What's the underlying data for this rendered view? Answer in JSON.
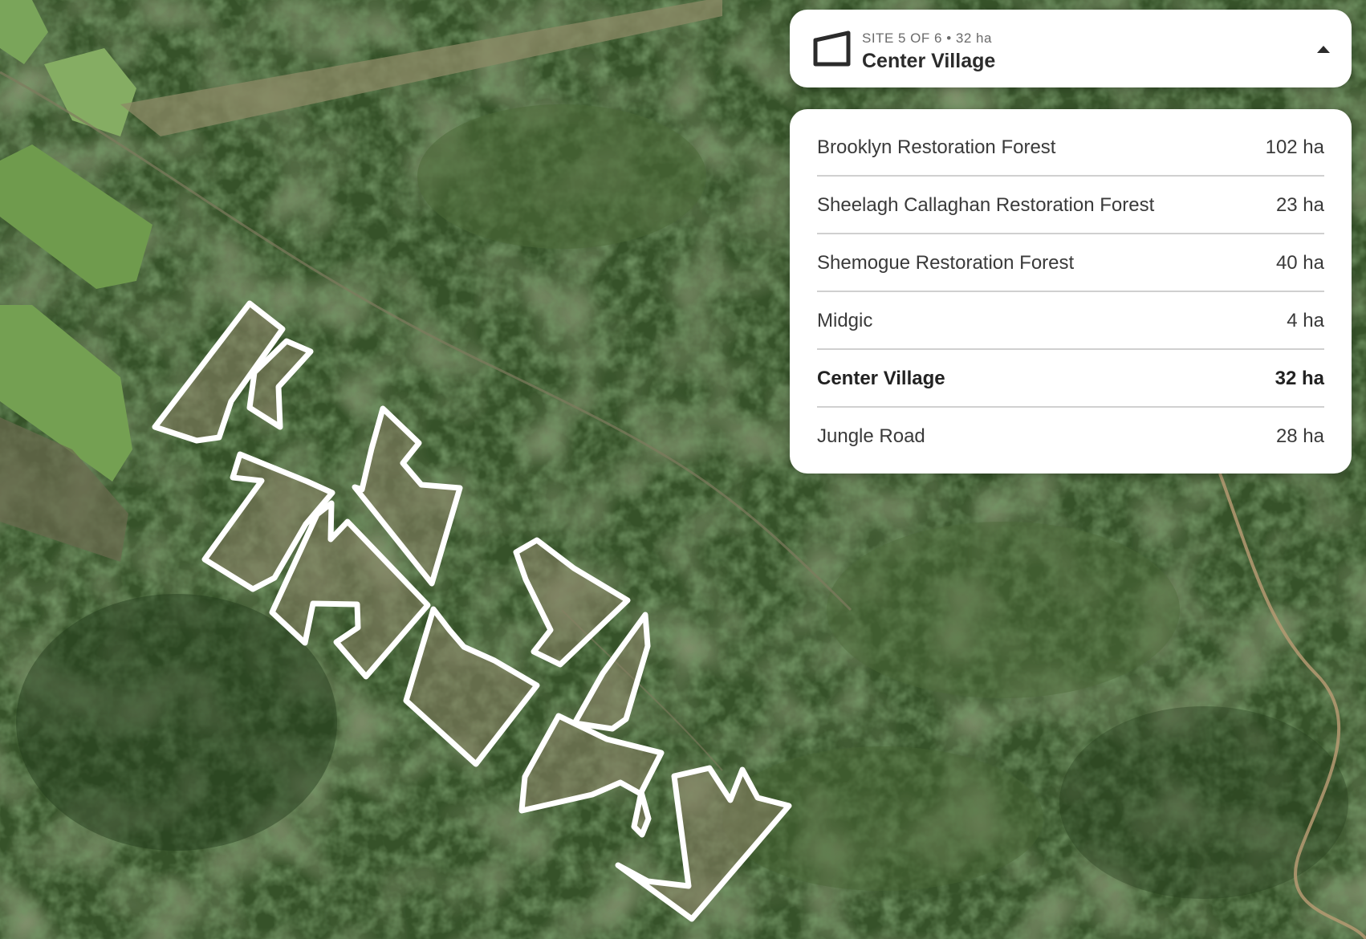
{
  "selected_site": {
    "meta": "SITE 5 OF 6 • 32 ha",
    "name": "Center Village"
  },
  "sites": [
    {
      "name": "Brooklyn Restoration Forest",
      "area": "102 ha",
      "selected": false
    },
    {
      "name": "Sheelagh Callaghan Restoration Forest",
      "area": "23 ha",
      "selected": false
    },
    {
      "name": "Shemogue Restoration Forest",
      "area": "40 ha",
      "selected": false
    },
    {
      "name": "Midgic",
      "area": "4 ha",
      "selected": false
    },
    {
      "name": "Center Village",
      "area": "32 ha",
      "selected": true
    },
    {
      "name": "Jungle Road",
      "area": "28 ha",
      "selected": false
    }
  ],
  "icons": {
    "site_icon": "polygon-icon",
    "collapse_icon": "caret-up-icon"
  },
  "colors": {
    "boundary": "#ffffff",
    "forest": "#2f4a22",
    "field": "#6d9c48",
    "clearcut": "#8a8468"
  }
}
